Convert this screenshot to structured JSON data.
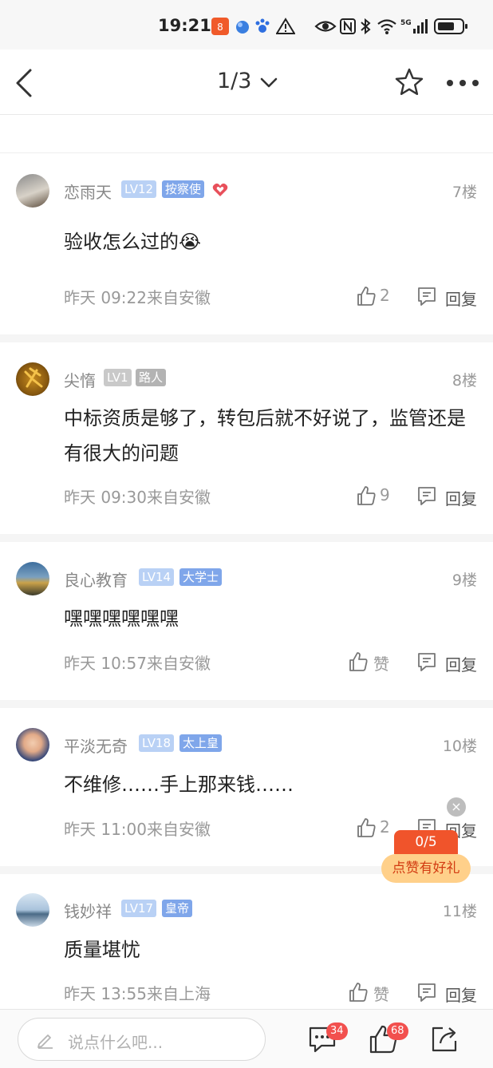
{
  "status_bar": {
    "time": "19:21",
    "network": "5G"
  },
  "header": {
    "page_indicator": "1/3"
  },
  "comments": [
    {
      "username": "恋雨天",
      "level": "LV12",
      "title": "按察使",
      "floor": "7楼",
      "content": "验收怎么过的",
      "emoji": "😭",
      "meta": "昨天 09:22来自安徽",
      "likes": "2",
      "reply": "回复"
    },
    {
      "username": "尖惰",
      "level": "LV1",
      "title": "路人",
      "floor": "8楼",
      "content": "中标资质是够了，转包后就不好说了，监管还是有很大的问题",
      "meta": "昨天 09:30来自安徽",
      "likes": "9",
      "reply": "回复"
    },
    {
      "username": "良心教育",
      "level": "LV14",
      "title": "大学士",
      "floor": "9楼",
      "content": "嘿嘿嘿嘿嘿嘿",
      "meta": "昨天 10:57来自安徽",
      "likes": "赞",
      "reply": "回复"
    },
    {
      "username": "平淡无奇",
      "level": "LV18",
      "title": "太上皇",
      "floor": "10楼",
      "content": "不维修……手上那来钱……",
      "meta": "昨天 11:00来自安徽",
      "likes": "2",
      "reply": "回复"
    },
    {
      "username": "钱妙祥",
      "level": "LV17",
      "title": "皇帝",
      "floor": "11楼",
      "content": "质量堪忧",
      "meta": "昨天 13:55来自上海",
      "likes": "赞",
      "reply": "回复"
    }
  ],
  "promo": {
    "count": "0/5",
    "label": "点赞有好礼",
    "close": "×"
  },
  "bottom_bar": {
    "placeholder": "说点什么吧...",
    "comments_badge": "34",
    "likes_badge": "68"
  }
}
